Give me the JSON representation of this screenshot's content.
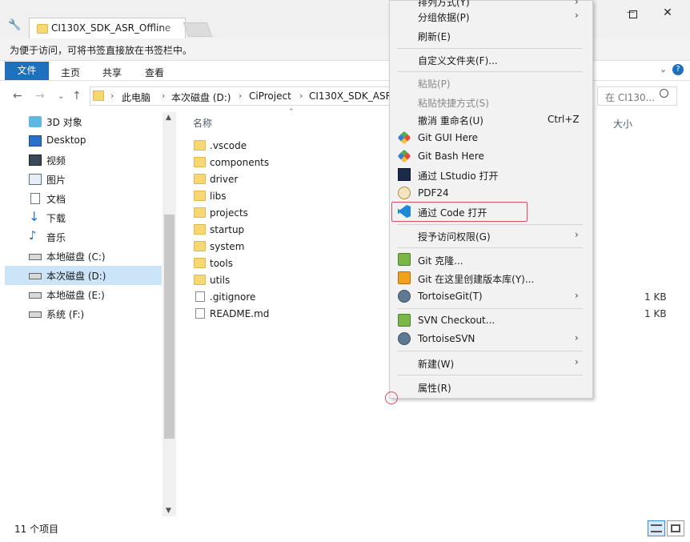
{
  "window": {
    "tab_title": "CI130X_SDK_ASR_Offline",
    "minimize": "—",
    "maximize": "☐",
    "close": "✕"
  },
  "bookmark_hint": "为便于访问，可将书签直接放在书签栏中。",
  "ribbon": {
    "tabs": [
      "文件",
      "主页",
      "共享",
      "查看"
    ]
  },
  "address": {
    "crumbs": [
      "此电脑",
      "本次磁盘 (D:)",
      "CiProject",
      "CI130X_SDK_ASR_"
    ],
    "search_placeholder": "在 CI130..."
  },
  "nav": {
    "items": [
      {
        "label": "3D 对象",
        "icon": "3d-objects-icon"
      },
      {
        "label": "Desktop",
        "icon": "desktop-icon"
      },
      {
        "label": "视频",
        "icon": "video-icon"
      },
      {
        "label": "图片",
        "icon": "pictures-icon"
      },
      {
        "label": "文档",
        "icon": "documents-icon"
      },
      {
        "label": "下载",
        "icon": "download-icon"
      },
      {
        "label": "音乐",
        "icon": "music-icon"
      },
      {
        "label": "本地磁盘 (C:)",
        "icon": "drive-icon"
      },
      {
        "label": "本次磁盘 (D:)",
        "icon": "drive-icon",
        "selected": true
      },
      {
        "label": "本地磁盘 (E:)",
        "icon": "drive-icon"
      },
      {
        "label": "系统 (F:)",
        "icon": "drive-icon"
      }
    ]
  },
  "columns": {
    "name": "名称",
    "size": "大小"
  },
  "files": [
    {
      "name": ".vscode",
      "type": "folder",
      "size": ""
    },
    {
      "name": "components",
      "type": "folder",
      "size": ""
    },
    {
      "name": "driver",
      "type": "folder",
      "size": ""
    },
    {
      "name": "libs",
      "type": "folder",
      "size": ""
    },
    {
      "name": "projects",
      "type": "folder",
      "size": ""
    },
    {
      "name": "startup",
      "type": "folder",
      "size": ""
    },
    {
      "name": "system",
      "type": "folder",
      "size": ""
    },
    {
      "name": "tools",
      "type": "folder",
      "size": ""
    },
    {
      "name": "utils",
      "type": "folder",
      "size": ""
    },
    {
      "name": ".gitignore",
      "type": "file",
      "size": "1 KB"
    },
    {
      "name": "README.md",
      "type": "file",
      "size": "1 KB"
    }
  ],
  "status": {
    "item_count": "11 个项目"
  },
  "context_menu": {
    "items": [
      {
        "label": "排列方式(Y)",
        "submenu": true
      },
      {
        "label": "分组依据(P)",
        "submenu": true
      },
      {
        "label": "刷新(E)"
      },
      {
        "label": "自定义文件夹(F)..."
      },
      {
        "label": "粘贴(P)",
        "disabled": true
      },
      {
        "label": "粘贴快捷方式(S)",
        "disabled": true
      },
      {
        "label": "撤消 重命名(U)",
        "shortcut": "Ctrl+Z"
      },
      {
        "label": "Git GUI Here",
        "icon": "git-gui-icon"
      },
      {
        "label": "Git Bash Here",
        "icon": "git-bash-icon"
      },
      {
        "label": "通过 LStudio 打开",
        "icon": "lstudio-icon"
      },
      {
        "label": "PDF24",
        "icon": "pdf24-icon"
      },
      {
        "label": "通过 Code 打开",
        "icon": "vscode-icon",
        "highlighted": true
      },
      {
        "label": "授予访问权限(G)",
        "submenu": true
      },
      {
        "label": "Git 克隆...",
        "icon": "tortoisegit-clone-icon"
      },
      {
        "label": "Git 在这里创建版本库(Y)...",
        "icon": "tortoisegit-create-icon"
      },
      {
        "label": "TortoiseGit(T)",
        "icon": "tortoisegit-icon",
        "submenu": true
      },
      {
        "label": "SVN Checkout...",
        "icon": "svn-checkout-icon"
      },
      {
        "label": "TortoiseSVN",
        "icon": "tortoisesvn-icon",
        "submenu": true
      },
      {
        "label": "新建(W)",
        "submenu": true
      },
      {
        "label": "属性(R)"
      }
    ]
  },
  "colors": {
    "accent": "#1f6fbf",
    "selection": "#cce4f7",
    "highlight_box": "#e04b5f",
    "folder": "#f6d772"
  }
}
